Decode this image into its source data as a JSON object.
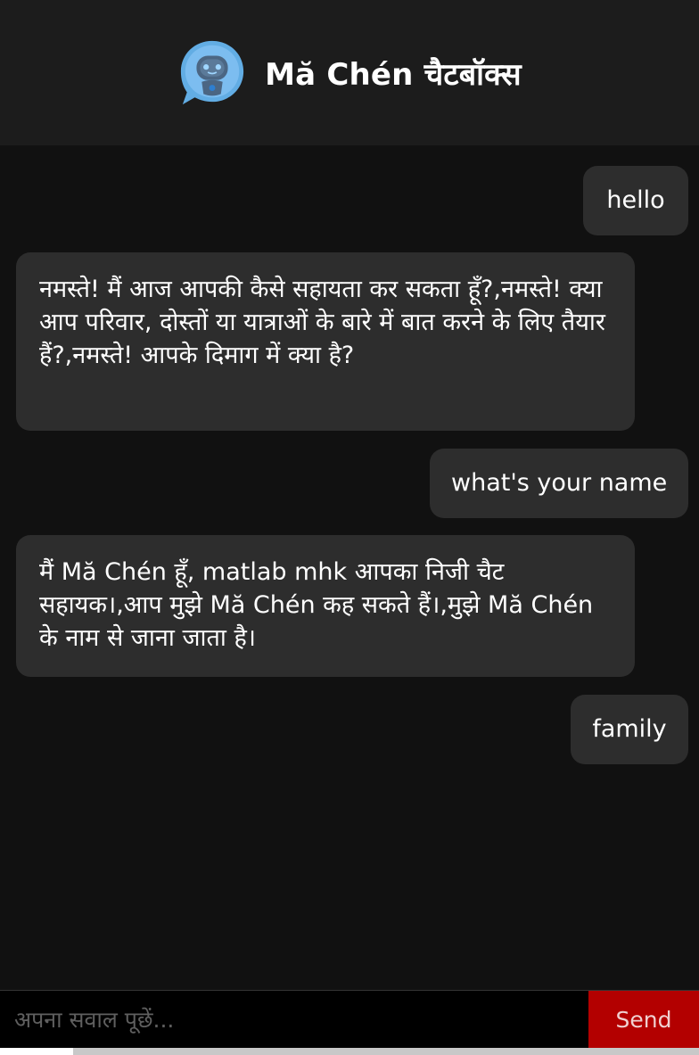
{
  "header": {
    "title": "Mă Chén चैटबॉक्स",
    "logo_icon": "robot-chat-bubble-icon"
  },
  "messages": [
    {
      "sender": "user",
      "text": "hello"
    },
    {
      "sender": "bot",
      "text": "नमस्ते! मैं आज आपकी कैसे सहायता कर सकता हूँ?,नमस्ते! क्या आप परिवार, दोस्तों या यात्राओं के बारे में बात करने के लिए तैयार हैं?,नमस्ते! आपके दिमाग में क्या है?"
    },
    {
      "sender": "user",
      "text": "what's your name"
    },
    {
      "sender": "bot",
      "text": "मैं Mă Chén हूँ, matlab mhk आपका निजी चैट सहायक।,आप मुझे Mă Chén कह सकते हैं।,मुझे Mă Chén के नाम से जाना जाता है।"
    },
    {
      "sender": "user",
      "text": "family"
    }
  ],
  "input": {
    "placeholder": "अपना सवाल पूछें...",
    "value": ""
  },
  "send_button": {
    "label": "Send"
  },
  "colors": {
    "background": "#111111",
    "header": "#1c1c1c",
    "bubble": "#2d2d2d",
    "send_button": "#b30000",
    "logo_blue": "#5aa9e0"
  }
}
